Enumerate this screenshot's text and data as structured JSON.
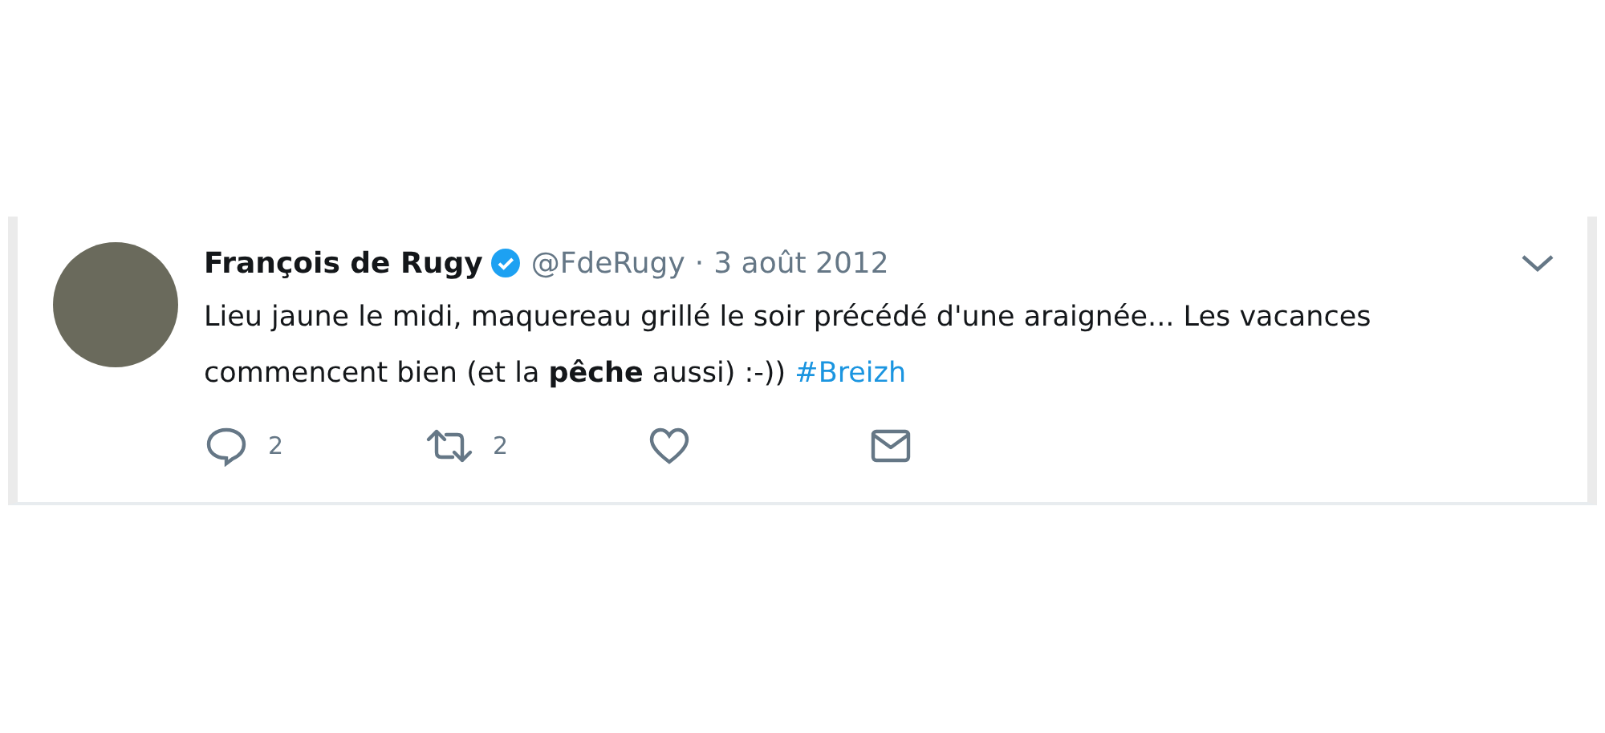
{
  "tweet": {
    "author": {
      "name": "François de Rugy",
      "verified": true,
      "handle": "@FdeRugy",
      "separator": "·",
      "date": "3 août 2012"
    },
    "text": "Lieu jaune le midi, maquereau grillé le soir précédé d'une araignée... Les vacances commencent bien (et la **pêche** aussi) :-))",
    "hashtag": "#Breizh",
    "actions": [
      {
        "kind": "reply",
        "count": "2"
      },
      {
        "kind": "retweet",
        "count": "2"
      },
      {
        "kind": "like"
      },
      {
        "kind": "message"
      }
    ]
  }
}
